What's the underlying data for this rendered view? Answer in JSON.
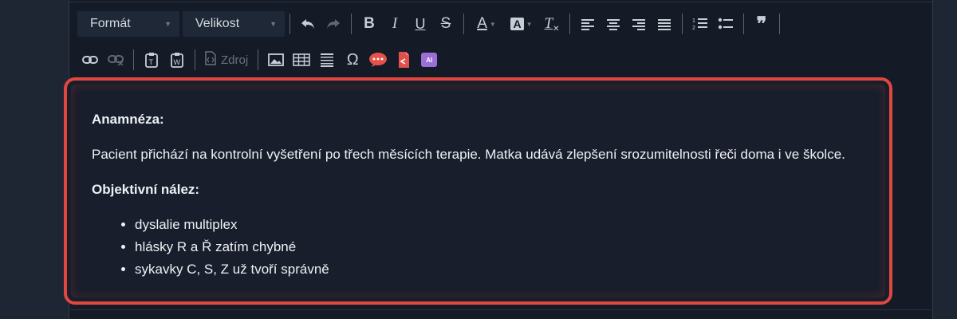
{
  "toolbar": {
    "format_label": "Formát",
    "size_label": "Velikost",
    "bold": "B",
    "italic": "I",
    "underline": "U",
    "strike": "S",
    "font_color": "A",
    "bg_color": "A",
    "remove_format": "T",
    "blockquote": "❞",
    "source_label": "Zdroj",
    "special_char": "Ω",
    "ai_label": "AI",
    "icons": [
      "undo-icon",
      "redo-icon",
      "align-left-icon",
      "align-center-icon",
      "align-right-icon",
      "justify-icon",
      "numbered-list-icon",
      "bullet-list-icon",
      "link-icon",
      "unlink-icon",
      "paste-text-icon",
      "paste-word-icon",
      "source-icon",
      "image-icon",
      "table-icon",
      "horizontal-rule-icon",
      "comment-icon",
      "template-icon",
      "ai-icon"
    ]
  },
  "content": {
    "h1": "Anamnéza:",
    "p1": "Pacient přichází na kontrolní vyšetření po třech měsících terapie. Matka udává zlepšení srozumitelnosti řeči doma i ve školce.",
    "h2": "Objektivní nález:",
    "items": [
      "dyslalie multiplex",
      "hlásky R a Ř zatím chybné",
      "sykavky C, S, Z už tvoří správně"
    ]
  },
  "colors": {
    "highlight_border": "#e2473f",
    "background": "#141b27"
  }
}
